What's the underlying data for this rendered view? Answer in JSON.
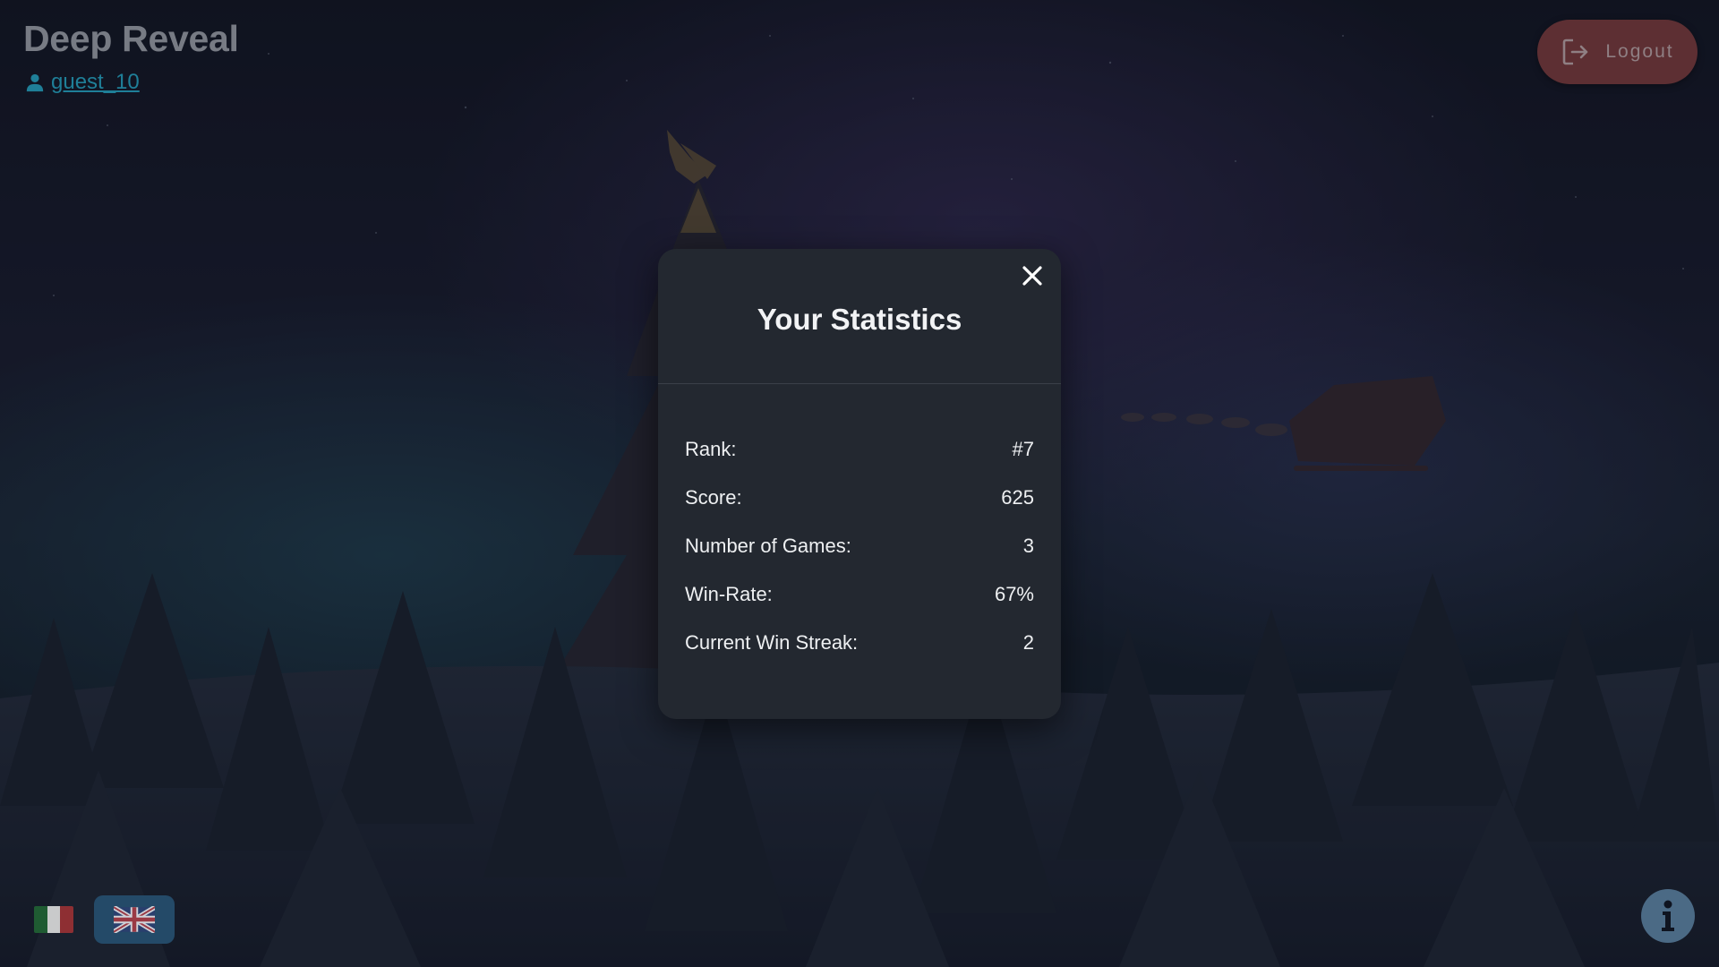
{
  "header": {
    "app_title": "Deep Reveal",
    "username": "guest_10",
    "user_icon": "person-icon",
    "logout_label": "Logout",
    "logout_icon": "logout-icon"
  },
  "modal": {
    "title": "Your Statistics",
    "close_icon": "close-icon",
    "stats": [
      {
        "label": "Rank:",
        "value": "#7"
      },
      {
        "label": "Score:",
        "value": "625"
      },
      {
        "label": "Number of Games:",
        "value": "3"
      },
      {
        "label": "Win-Rate:",
        "value": "67%"
      },
      {
        "label": "Current Win Streak:",
        "value": "2"
      }
    ]
  },
  "footer": {
    "languages": [
      {
        "code": "it",
        "icon": "italian-flag-icon",
        "selected": false
      },
      {
        "code": "en",
        "icon": "uk-flag-icon",
        "selected": true
      }
    ],
    "info_icon": "info-icon"
  },
  "colors": {
    "modal_bg": "#232830",
    "logout_bg": "#5d2f33",
    "user_link": "#1f7f98",
    "info_bg": "#4b6a85",
    "lang_selected_bg": "#244a68"
  }
}
